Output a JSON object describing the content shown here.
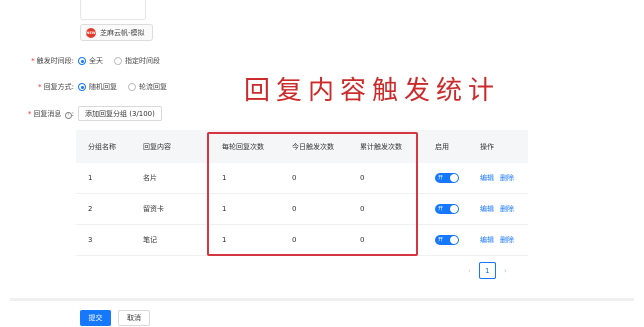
{
  "account": {
    "logo_text": "NEW",
    "name": "芝麻云帆-模拟"
  },
  "trigger_time": {
    "label": "触发时间段:",
    "options": [
      {
        "label": "全天",
        "selected": true
      },
      {
        "label": "指定时间段",
        "selected": false
      }
    ]
  },
  "reply_mode": {
    "label": "回复方式:",
    "options": [
      {
        "label": "随机回复",
        "selected": true
      },
      {
        "label": "轮流回复",
        "selected": false
      }
    ]
  },
  "reply_message": {
    "label": "回复消息",
    "add_button": "添加回复分组 (3/100)"
  },
  "overlay_title": "回复内容触发统计",
  "table": {
    "headers": [
      "分组名称",
      "回复内容",
      "每轮回复次数",
      "今日触发次数",
      "累计触发次数",
      "启用",
      "操作"
    ],
    "rows": [
      {
        "group": "1",
        "content": "名片",
        "per_round": "1",
        "today": "0",
        "total": "0",
        "toggle": "开",
        "enabled": true,
        "edit": "编辑",
        "delete": "删除"
      },
      {
        "group": "2",
        "content": "留资卡",
        "per_round": "1",
        "today": "0",
        "total": "0",
        "toggle": "开",
        "enabled": true,
        "edit": "编辑",
        "delete": "删除"
      },
      {
        "group": "3",
        "content": "笔记",
        "per_round": "1",
        "today": "0",
        "total": "0",
        "toggle": "开",
        "enabled": true,
        "edit": "编辑",
        "delete": "删除"
      }
    ]
  },
  "pagination": {
    "prev": "‹",
    "current": "1",
    "next": "›"
  },
  "footer": {
    "submit": "提交",
    "cancel": "取消"
  },
  "colors": {
    "primary": "#1677ff",
    "highlight": "#d6363f",
    "required": "#f5222d"
  }
}
